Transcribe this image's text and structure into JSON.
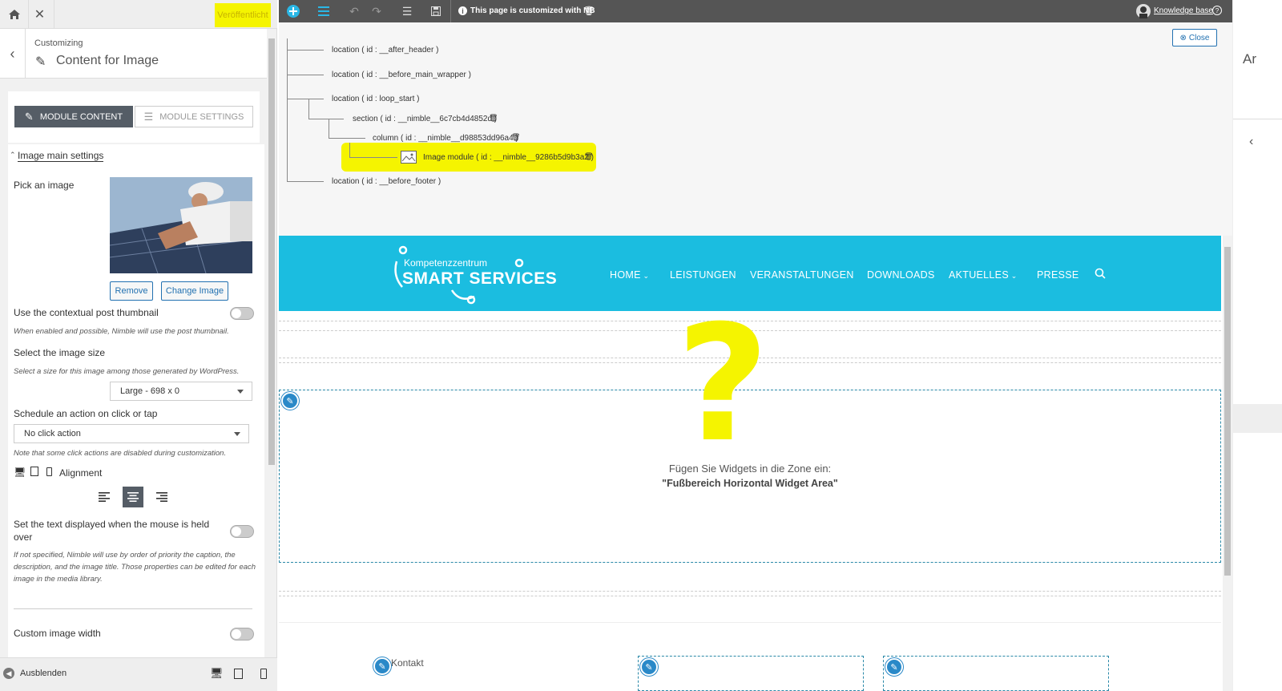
{
  "topbar": {
    "publish_label": "Veröffentlicht"
  },
  "header": {
    "crumb": "Customizing",
    "title": "Content for Image"
  },
  "tabs": {
    "content": "MODULE CONTENT",
    "settings": "MODULE SETTINGS"
  },
  "form": {
    "section_title": "Image main settings",
    "pick_image_label": "Pick an image",
    "remove_label": "Remove",
    "change_label": "Change Image",
    "contextual_label": "Use the contextual post thumbnail",
    "contextual_desc": "When enabled and possible, Nimble will use the post thumbnail.",
    "size_label": "Select the image size",
    "size_desc": "Select a size for this image among those generated by WordPress.",
    "size_value": "Large - 698 x 0",
    "action_label": "Schedule an action on click or tap",
    "action_value": "No click action",
    "action_desc": "Note that some click actions are disabled during customization.",
    "alignment_label": "Alignment",
    "hover_label_1": "Set the text displayed when the mouse is held",
    "hover_label_2": "over",
    "hover_desc_1": "If not specified, Nimble will use by order of priority the caption, the",
    "hover_desc_2": "description, and the image title. Those properties can be edited for each",
    "hover_desc_3": "image in the media library.",
    "width_label": "Custom image width"
  },
  "footer": {
    "hide_label": "Ausblenden"
  },
  "nbbar": {
    "notice": "This page is customized with NB",
    "kb_label": "Knowledge base"
  },
  "tree": {
    "close_label": "Close",
    "n1": "location ( id : __after_header )",
    "n2": "location ( id : __before_main_wrapper )",
    "n3": "location ( id : loop_start )",
    "n4": "section ( id : __nimble__6c7cb4d4852d )",
    "n5": "column ( id : __nimble__d98853dd96a4 )",
    "n6": "Image module ( id : __nimble__9286b5d9b3a2 )",
    "n7": "location ( id : __before_footer )"
  },
  "site": {
    "logo_top": "Kompetenzzentrum",
    "logo_main": "SMART SERVICES",
    "nav": [
      "HOME",
      "LEISTUNGEN",
      "VERANSTALTUNGEN",
      "DOWNLOADS",
      "AKTUELLES",
      "PRESSE"
    ],
    "widget_line1": "Fügen Sie Widgets in die Zone ein:",
    "widget_line2": "\"Fußbereich Horizontal Widget Area\"",
    "footer_kontakt": "Kontakt",
    "question_mark": "?",
    "farright_text": "Ar"
  },
  "colors": {
    "highlight": "#f5f400",
    "nav_bg": "#1bbde0",
    "dark_tab": "#555d66",
    "link": "#2271b1"
  },
  "icons": [
    "home-icon",
    "close-icon",
    "chevron-left-icon",
    "pencil-icon",
    "plus-circle-icon",
    "list-icon",
    "undo-icon",
    "redo-icon",
    "sliders-icon",
    "save-icon",
    "info-icon",
    "trash-icon",
    "help-icon",
    "search-icon",
    "desktop-icon",
    "tablet-icon",
    "mobile-icon",
    "image-icon"
  ]
}
